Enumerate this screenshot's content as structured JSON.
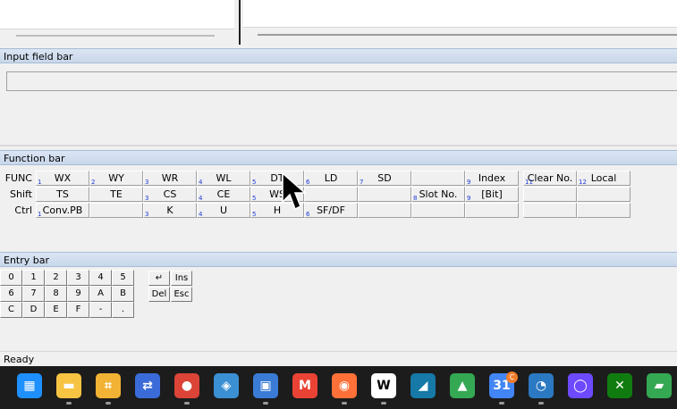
{
  "panels": {
    "input_header": "Input field bar",
    "function_header": "Function bar",
    "entry_header": "Entry bar"
  },
  "input_field": {
    "value": ""
  },
  "function_bar": {
    "row_labels": [
      "FUNC",
      "Shift",
      "Ctrl"
    ],
    "rows": [
      [
        {
          "num": "1",
          "label": "WX"
        },
        {
          "num": "2",
          "label": "WY"
        },
        {
          "num": "3",
          "label": "WR"
        },
        {
          "num": "4",
          "label": "WL"
        },
        {
          "num": "5",
          "label": "DT"
        },
        {
          "num": "6",
          "label": "LD"
        },
        {
          "num": "7",
          "label": "SD"
        },
        {
          "num": "",
          "label": ""
        },
        {
          "num": "9",
          "label": "Index"
        },
        {
          "num": "11",
          "label": "Clear No."
        },
        {
          "num": "12",
          "label": "Local"
        }
      ],
      [
        {
          "num": "",
          "label": "TS"
        },
        {
          "num": "",
          "label": "TE"
        },
        {
          "num": "3",
          "label": "CS"
        },
        {
          "num": "4",
          "label": "CE"
        },
        {
          "num": "5",
          "label": "WS"
        },
        {
          "num": "",
          "label": ""
        },
        {
          "num": "",
          "label": ""
        },
        {
          "num": "8",
          "label": "Slot No."
        },
        {
          "num": "9",
          "label": "[Bit]"
        },
        {
          "num": "",
          "label": ""
        },
        {
          "num": "",
          "label": ""
        }
      ],
      [
        {
          "num": "1",
          "label": "Conv.PB"
        },
        {
          "num": "",
          "label": ""
        },
        {
          "num": "3",
          "label": "K"
        },
        {
          "num": "4",
          "label": "U"
        },
        {
          "num": "5",
          "label": "H"
        },
        {
          "num": "6",
          "label": "SF/DF"
        },
        {
          "num": "",
          "label": ""
        },
        {
          "num": "",
          "label": ""
        },
        {
          "num": "",
          "label": ""
        },
        {
          "num": "",
          "label": ""
        },
        {
          "num": "",
          "label": ""
        }
      ]
    ]
  },
  "entry_bar": {
    "keys": [
      [
        "0",
        "1",
        "2",
        "3",
        "4",
        "5"
      ],
      [
        "6",
        "7",
        "8",
        "9",
        "A",
        "B"
      ],
      [
        "C",
        "D",
        "E",
        "F",
        "-",
        "."
      ]
    ],
    "special": [
      [
        "↵",
        "Ins"
      ],
      [
        "Del",
        "Esc"
      ]
    ]
  },
  "status": {
    "text": "Ready"
  },
  "taskbar": {
    "icons": [
      {
        "name": "windows-start-icon",
        "color": "#1e90ff",
        "glyph": "▦",
        "indicator": false
      },
      {
        "name": "file-explorer-icon",
        "color": "#f6c343",
        "glyph": "▬",
        "indicator": true
      },
      {
        "name": "network-tool-icon",
        "color": "#f2b233",
        "glyph": "⌗",
        "indicator": true
      },
      {
        "name": "network-connections-icon",
        "color": "#3a6bd8",
        "glyph": "⇄",
        "indicator": false
      },
      {
        "name": "chrome-icon",
        "color": "#db4437",
        "glyph": "●",
        "indicator": true
      },
      {
        "name": "virtualbox-icon",
        "color": "#3b8fd3",
        "glyph": "◈",
        "indicator": false
      },
      {
        "name": "remote-desktop-icon",
        "color": "#3a7bd5",
        "glyph": "▣",
        "indicator": true
      },
      {
        "name": "gmail-icon",
        "color": "#ea4335",
        "glyph": "M",
        "indicator": false
      },
      {
        "name": "firefox-icon",
        "color": "#ff7139",
        "glyph": "◉",
        "indicator": true
      },
      {
        "name": "works-app-icon",
        "color": "#ffffff",
        "glyph": "W",
        "indicator": true
      },
      {
        "name": "wireshark-icon",
        "color": "#1679a7",
        "glyph": "◢",
        "indicator": false
      },
      {
        "name": "google-drive-icon",
        "color": "#34a853",
        "glyph": "▲",
        "indicator": false
      },
      {
        "name": "calendar-icon",
        "color": "#4285f4",
        "glyph": "31",
        "indicator": true
      },
      {
        "name": "dashboard-icon",
        "color": "#2b79c2",
        "glyph": "◔",
        "indicator": true
      },
      {
        "name": "proton-icon",
        "color": "#6d4aff",
        "glyph": "◯",
        "indicator": false
      },
      {
        "name": "xbox-icon",
        "color": "#107c10",
        "glyph": "✕",
        "indicator": false
      },
      {
        "name": "chat-icon",
        "color": "#34a853",
        "glyph": "▰",
        "indicator": false
      }
    ],
    "calendar_badge": "C"
  }
}
